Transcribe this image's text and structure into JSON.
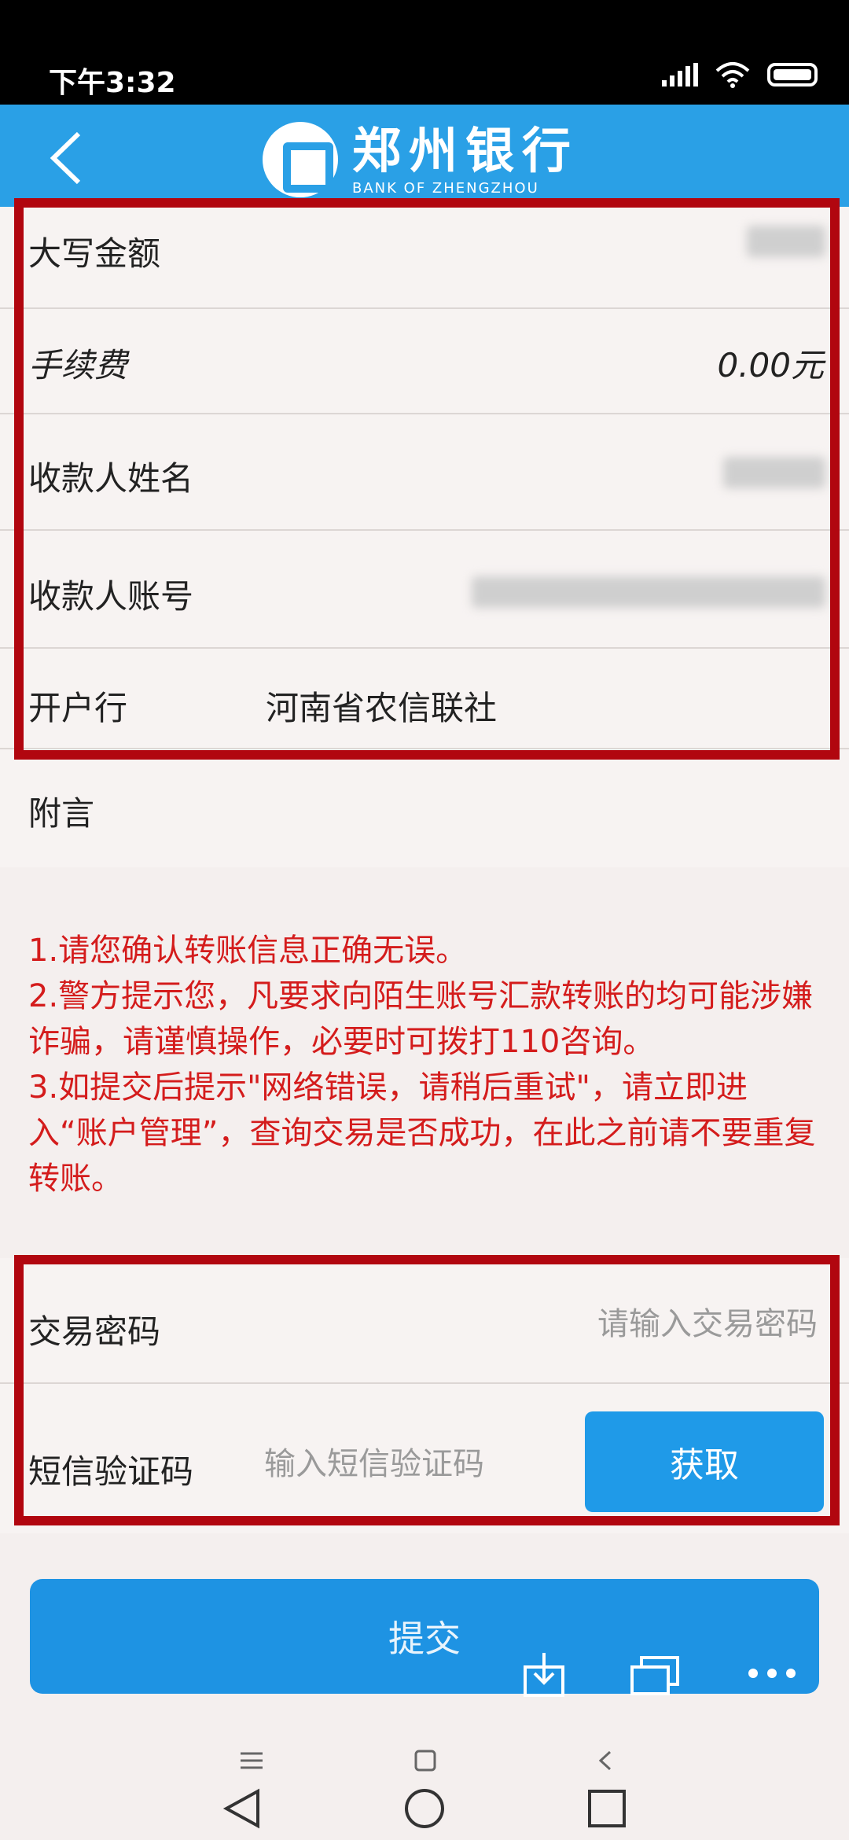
{
  "status_bar": {
    "time": "下午3:32"
  },
  "header": {
    "logo_cn": "郑州银行",
    "logo_en": "BANK OF ZHENGZHOU"
  },
  "fields": {
    "amount_in_words": {
      "label": "大写金额"
    },
    "fee": {
      "label": "手续费",
      "value": "0.00元"
    },
    "payee_name": {
      "label": "收款人姓名"
    },
    "payee_account": {
      "label": "收款人账号"
    },
    "bank": {
      "label": "开户行",
      "value": "河南省农信联社"
    },
    "memo": {
      "label": "附言"
    }
  },
  "notice": {
    "line1": "1.请您确认转账信息正确无误。",
    "line2": "2.警方提示您，凡要求向陌生账号汇款转账的均可能涉嫌诈骗，请谨慎操作，必要时可拨打110咨询。",
    "line3": "3.如提交后提示\"网络错误，请稍后重试\"，请立即进入“账户管理”，查询交易是否成功，在此之前请不要重复转账。"
  },
  "password": {
    "label": "交易密码",
    "placeholder": "请输入交易密码"
  },
  "sms": {
    "label": "短信验证码",
    "placeholder": "输入短信验证码",
    "button": "获取"
  },
  "submit": {
    "label": "提交"
  },
  "colors": {
    "header_blue": "#2aa0e6",
    "button_blue": "#1f9ae8",
    "warning_red": "#d41c1c",
    "highlight_red": "#b1060f"
  }
}
